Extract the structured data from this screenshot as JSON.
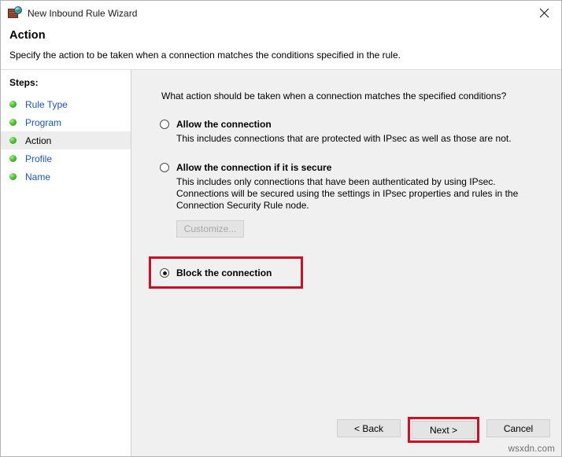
{
  "window": {
    "title": "New Inbound Rule Wizard",
    "icon": "firewall-globe-icon",
    "close_label": "✕"
  },
  "header": {
    "title": "Action",
    "subtitle": "Specify the action to be taken when a connection matches the conditions specified in the rule."
  },
  "sidebar": {
    "heading": "Steps:",
    "items": [
      {
        "label": "Rule Type",
        "current": false
      },
      {
        "label": "Program",
        "current": false
      },
      {
        "label": "Action",
        "current": true
      },
      {
        "label": "Profile",
        "current": false
      },
      {
        "label": "Name",
        "current": false
      }
    ]
  },
  "main": {
    "question": "What action should be taken when a connection matches the specified conditions?",
    "options": [
      {
        "title": "Allow the connection",
        "description": "This includes connections that are protected with IPsec as well as those are not.",
        "selected": false
      },
      {
        "title": "Allow the connection if it is secure",
        "description": "This includes only connections that have been authenticated by using IPsec.  Connections will be secured using the settings in IPsec properties and rules in the Connection Security Rule node.",
        "selected": false
      },
      {
        "title": "Block the connection",
        "description": "",
        "selected": true
      }
    ],
    "customize_button": "Customize...",
    "customize_disabled": true
  },
  "footer": {
    "back_label": "< Back",
    "next_label": "Next >",
    "cancel_label": "Cancel"
  },
  "watermark": "wsxdn.com",
  "colors": {
    "annotation_red": "#cc1122",
    "link_blue": "#1a56c4",
    "panel_gray": "#f0f0f0",
    "bullet_green": "#4cc534"
  }
}
